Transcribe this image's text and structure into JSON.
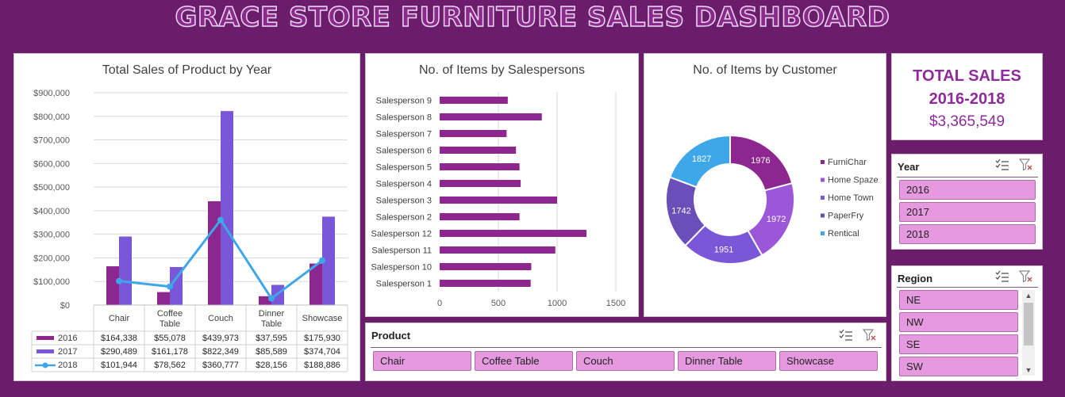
{
  "title": "GRACE STORE FURNITURE SALES DASHBOARD",
  "colors": {
    "c2016": "#8e2690",
    "c2017": "#7a56d8",
    "c2018": "#3ea7ea",
    "slicer_item": "#e59ae0"
  },
  "chart_sales": {
    "type": "bar",
    "title": "Total Sales of Product by Year",
    "categories": [
      "Chair",
      "Coffee Table",
      "Couch",
      "Dinner Table",
      "Showcase"
    ],
    "category_lines": [
      [
        "Chair"
      ],
      [
        "Coffee",
        "Table"
      ],
      [
        "Couch"
      ],
      [
        "Dinner",
        "Table"
      ],
      [
        "Showcase"
      ]
    ],
    "ylim": [
      0,
      900000
    ],
    "yticks": [
      0,
      100000,
      200000,
      300000,
      400000,
      500000,
      600000,
      700000,
      800000,
      900000
    ],
    "ytick_labels": [
      "$0",
      "$100,000",
      "$200,000",
      "$300,000",
      "$400,000",
      "$500,000",
      "$600,000",
      "$700,000",
      "$800,000",
      "$900,000"
    ],
    "series": [
      {
        "name": "2016",
        "kind": "bar",
        "values": [
          164338,
          55078,
          439973,
          37595,
          175930
        ],
        "labels": [
          "$164,338",
          "$55,078",
          "$439,973",
          "$37,595",
          "$175,930"
        ]
      },
      {
        "name": "2017",
        "kind": "bar",
        "values": [
          290489,
          161178,
          822349,
          85589,
          374704
        ],
        "labels": [
          "$290,489",
          "$161,178",
          "$822,349",
          "$85,589",
          "$374,704"
        ]
      },
      {
        "name": "2018",
        "kind": "line",
        "values": [
          101944,
          78562,
          360777,
          28156,
          188886
        ],
        "labels": [
          "$101,944",
          "$78,562",
          "$360,777",
          "$28,156",
          "$188,886"
        ]
      }
    ]
  },
  "chart_salespersons": {
    "type": "bar",
    "orientation": "horizontal",
    "title": "No. of Items by Salespersons",
    "categories": [
      "Salesperson 9",
      "Salesperson 8",
      "Salesperson 7",
      "Salesperson 6",
      "Salesperson 5",
      "Salesperson 4",
      "Salesperson 3",
      "Salesperson 2",
      "Salesperson 12",
      "Salesperson 11",
      "Salesperson 10",
      "Salesperson 1"
    ],
    "values": [
      580,
      870,
      570,
      650,
      680,
      690,
      1000,
      680,
      1250,
      985,
      780,
      775
    ],
    "xlim": [
      0,
      1500
    ],
    "xticks": [
      0,
      500,
      1000,
      1500
    ],
    "xtick_labels": [
      "0",
      "500",
      "1000",
      "1500"
    ]
  },
  "chart_customers": {
    "type": "pie",
    "title": "No. of Items by Customer",
    "legend": "right",
    "slices": [
      {
        "name": "FurniChar",
        "value": 1976,
        "label": "1976",
        "color": "#8e2690"
      },
      {
        "name": "Home Spaze",
        "value": 1972,
        "label": "1972",
        "color": "#9b57d8"
      },
      {
        "name": "Home Town",
        "value": 1951,
        "label": "1951",
        "color": "#7a56d8"
      },
      {
        "name": "PaperFry",
        "value": 1742,
        "label": "1742",
        "color": "#6a4fb8"
      },
      {
        "name": "Rentical",
        "value": 1827,
        "label": "1827",
        "color": "#3ea7ea"
      }
    ]
  },
  "total": {
    "line1": "TOTAL SALES",
    "line2": "2016-2018",
    "amount": "$3,365,549"
  },
  "slicer_year": {
    "header": "Year",
    "items": [
      "2016",
      "2017",
      "2018"
    ]
  },
  "slicer_region": {
    "header": "Region",
    "items": [
      "NE",
      "NW",
      "SE",
      "SW"
    ]
  },
  "slicer_product": {
    "header": "Product",
    "items": [
      "Chair",
      "Coffee Table",
      "Couch",
      "Dinner Table",
      "Showcase"
    ]
  }
}
